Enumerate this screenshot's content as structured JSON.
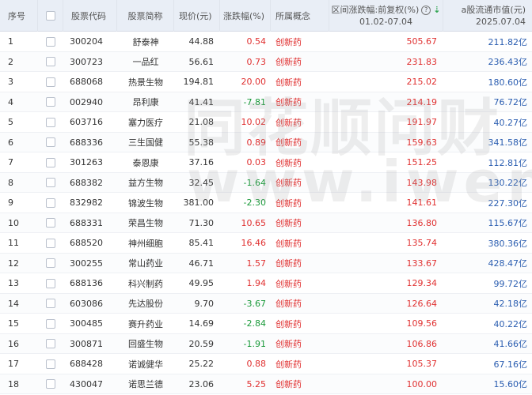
{
  "headers": {
    "index": "序号",
    "code": "股票代码",
    "name": "股票简称",
    "price": "现价(元)",
    "change": "涨跌幅(%)",
    "concept": "所属概念",
    "range_line1": "区间涨跌幅:前复权(%)",
    "range_line2": "01.02-07.04",
    "mcap_line1": "a股流通市值(元)",
    "mcap_line2": "2025.07.04"
  },
  "watermark": {
    "line1": "同花顺问财",
    "line2": "www.iwencai.com"
  },
  "colors": {
    "up": "#e03030",
    "down": "#1a9a3a",
    "link": "#2a5db0",
    "header_bg": "#e9eef6"
  },
  "rows": [
    {
      "no": "1",
      "code": "300204",
      "name": "舒泰神",
      "price": "44.88",
      "change": "0.54",
      "dir": "up",
      "concept": "创新药",
      "range": "505.67",
      "mcap": "211.82亿"
    },
    {
      "no": "2",
      "code": "300723",
      "name": "一品红",
      "price": "56.61",
      "change": "0.73",
      "dir": "up",
      "concept": "创新药",
      "range": "231.83",
      "mcap": "236.43亿"
    },
    {
      "no": "3",
      "code": "688068",
      "name": "热景生物",
      "price": "194.81",
      "change": "20.00",
      "dir": "up",
      "concept": "创新药",
      "range": "215.02",
      "mcap": "180.60亿"
    },
    {
      "no": "4",
      "code": "002940",
      "name": "昂利康",
      "price": "41.41",
      "change": "-7.81",
      "dir": "down",
      "concept": "创新药",
      "range": "214.19",
      "mcap": "76.72亿"
    },
    {
      "no": "5",
      "code": "603716",
      "name": "塞力医疗",
      "price": "21.08",
      "change": "10.02",
      "dir": "up",
      "concept": "创新药",
      "range": "191.97",
      "mcap": "40.27亿"
    },
    {
      "no": "6",
      "code": "688336",
      "name": "三生国健",
      "price": "55.38",
      "change": "0.89",
      "dir": "up",
      "concept": "创新药",
      "range": "159.63",
      "mcap": "341.58亿"
    },
    {
      "no": "7",
      "code": "301263",
      "name": "泰恩康",
      "price": "37.16",
      "change": "0.03",
      "dir": "up",
      "concept": "创新药",
      "range": "151.25",
      "mcap": "112.81亿"
    },
    {
      "no": "8",
      "code": "688382",
      "name": "益方生物",
      "price": "32.45",
      "change": "-1.64",
      "dir": "down",
      "concept": "创新药",
      "range": "143.98",
      "mcap": "130.22亿"
    },
    {
      "no": "9",
      "code": "832982",
      "name": "锦波生物",
      "price": "381.00",
      "change": "-2.30",
      "dir": "down",
      "concept": "创新药",
      "range": "141.61",
      "mcap": "227.30亿"
    },
    {
      "no": "10",
      "code": "688331",
      "name": "荣昌生物",
      "price": "71.30",
      "change": "10.65",
      "dir": "up",
      "concept": "创新药",
      "range": "136.80",
      "mcap": "115.67亿"
    },
    {
      "no": "11",
      "code": "688520",
      "name": "神州细胞",
      "price": "85.41",
      "change": "16.46",
      "dir": "up",
      "concept": "创新药",
      "range": "135.74",
      "mcap": "380.36亿"
    },
    {
      "no": "12",
      "code": "300255",
      "name": "常山药业",
      "price": "46.71",
      "change": "1.57",
      "dir": "up",
      "concept": "创新药",
      "range": "133.67",
      "mcap": "428.47亿"
    },
    {
      "no": "13",
      "code": "688136",
      "name": "科兴制药",
      "price": "49.95",
      "change": "1.94",
      "dir": "up",
      "concept": "创新药",
      "range": "129.34",
      "mcap": "99.72亿"
    },
    {
      "no": "14",
      "code": "603086",
      "name": "先达股份",
      "price": "9.70",
      "change": "-3.67",
      "dir": "down",
      "concept": "创新药",
      "range": "126.64",
      "mcap": "42.18亿"
    },
    {
      "no": "15",
      "code": "300485",
      "name": "赛升药业",
      "price": "14.69",
      "change": "-2.84",
      "dir": "down",
      "concept": "创新药",
      "range": "109.56",
      "mcap": "40.22亿"
    },
    {
      "no": "16",
      "code": "300871",
      "name": "回盛生物",
      "price": "20.59",
      "change": "-1.91",
      "dir": "down",
      "concept": "创新药",
      "range": "106.86",
      "mcap": "41.66亿"
    },
    {
      "no": "17",
      "code": "688428",
      "name": "诺诚健华",
      "price": "25.22",
      "change": "0.88",
      "dir": "up",
      "concept": "创新药",
      "range": "105.37",
      "mcap": "67.16亿"
    },
    {
      "no": "18",
      "code": "430047",
      "name": "诺思兰德",
      "price": "23.06",
      "change": "5.25",
      "dir": "up",
      "concept": "创新药",
      "range": "100.00",
      "mcap": "15.60亿"
    }
  ]
}
